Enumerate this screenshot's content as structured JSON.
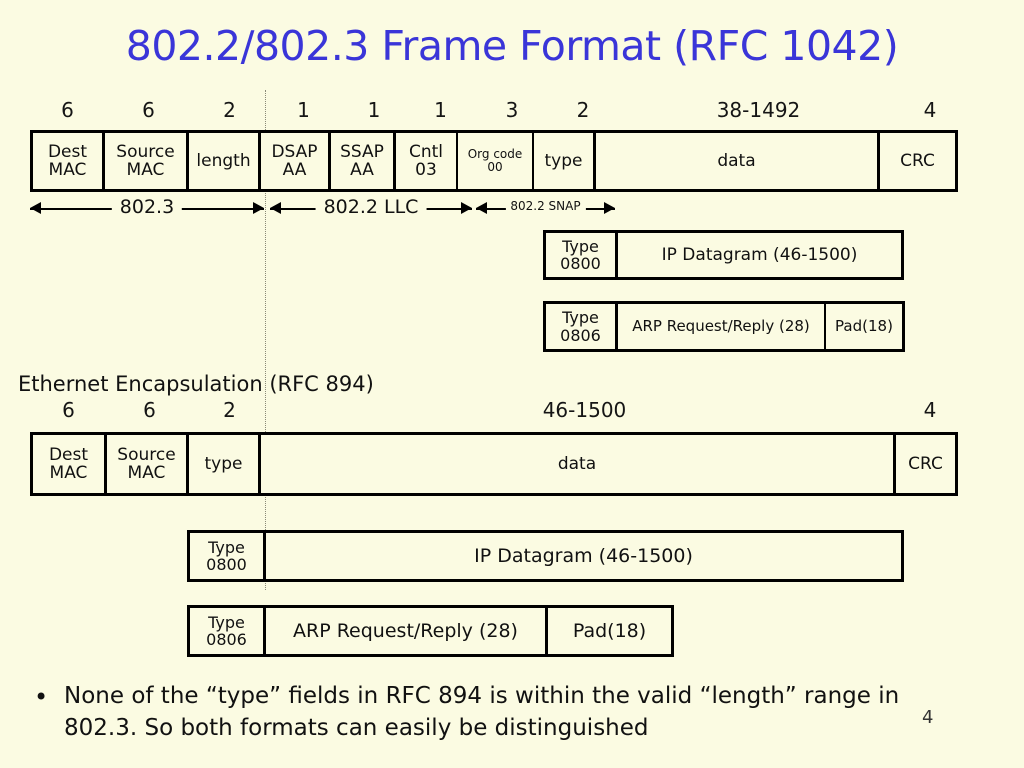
{
  "slide": {
    "title": "802.2/802.3 Frame Format (RFC 1042)",
    "page_number": "4",
    "title_color": "#3a35d8",
    "background_color": "#fbfbe2",
    "line_color": "#000000"
  },
  "frame_8022": {
    "sizes": [
      "6",
      "6",
      "2",
      "1",
      "1",
      "1",
      "3",
      "2",
      "38-1492",
      "4"
    ],
    "fields": [
      {
        "line1": "Dest",
        "line2": "MAC"
      },
      {
        "line1": "Source",
        "line2": "MAC"
      },
      {
        "line1": "length",
        "line2": ""
      },
      {
        "line1": "DSAP",
        "line2": "AA"
      },
      {
        "line1": "SSAP",
        "line2": "AA"
      },
      {
        "line1": "Cntl",
        "line2": "03"
      },
      {
        "line1": "Org code",
        "line2": "00"
      },
      {
        "line1": "type",
        "line2": ""
      },
      {
        "line1": "data",
        "line2": ""
      },
      {
        "line1": "CRC",
        "line2": ""
      }
    ],
    "ranges": [
      {
        "label": "802.3"
      },
      {
        "label": "802.2 LLC"
      },
      {
        "label": "802.2 SNAP"
      }
    ]
  },
  "snap_payloads": [
    {
      "type_line1": "Type",
      "type_line2": "0800",
      "payload": "IP Datagram (46-1500)",
      "pad": ""
    },
    {
      "type_line1": "Type",
      "type_line2": "0806",
      "payload": "ARP Request/Reply (28)",
      "pad": "Pad(18)"
    }
  ],
  "ethernet": {
    "caption": "Ethernet Encapsulation (RFC 894)",
    "sizes": [
      "6",
      "6",
      "2",
      "46-1500",
      "4"
    ],
    "fields": [
      {
        "line1": "Dest",
        "line2": "MAC"
      },
      {
        "line1": "Source",
        "line2": "MAC"
      },
      {
        "line1": "type",
        "line2": ""
      },
      {
        "line1": "data",
        "line2": ""
      },
      {
        "line1": "CRC",
        "line2": ""
      }
    ],
    "payloads": [
      {
        "type_line1": "Type",
        "type_line2": "0800",
        "payload": "IP Datagram (46-1500)",
        "pad": ""
      },
      {
        "type_line1": "Type",
        "type_line2": "0806",
        "payload": "ARP Request/Reply (28)",
        "pad": "Pad(18)"
      }
    ]
  },
  "bullet": {
    "marker": "•",
    "text": "None of the “type” fields in RFC 894 is within the valid “length” range in 802.3. So both formats can easily be distinguished"
  }
}
